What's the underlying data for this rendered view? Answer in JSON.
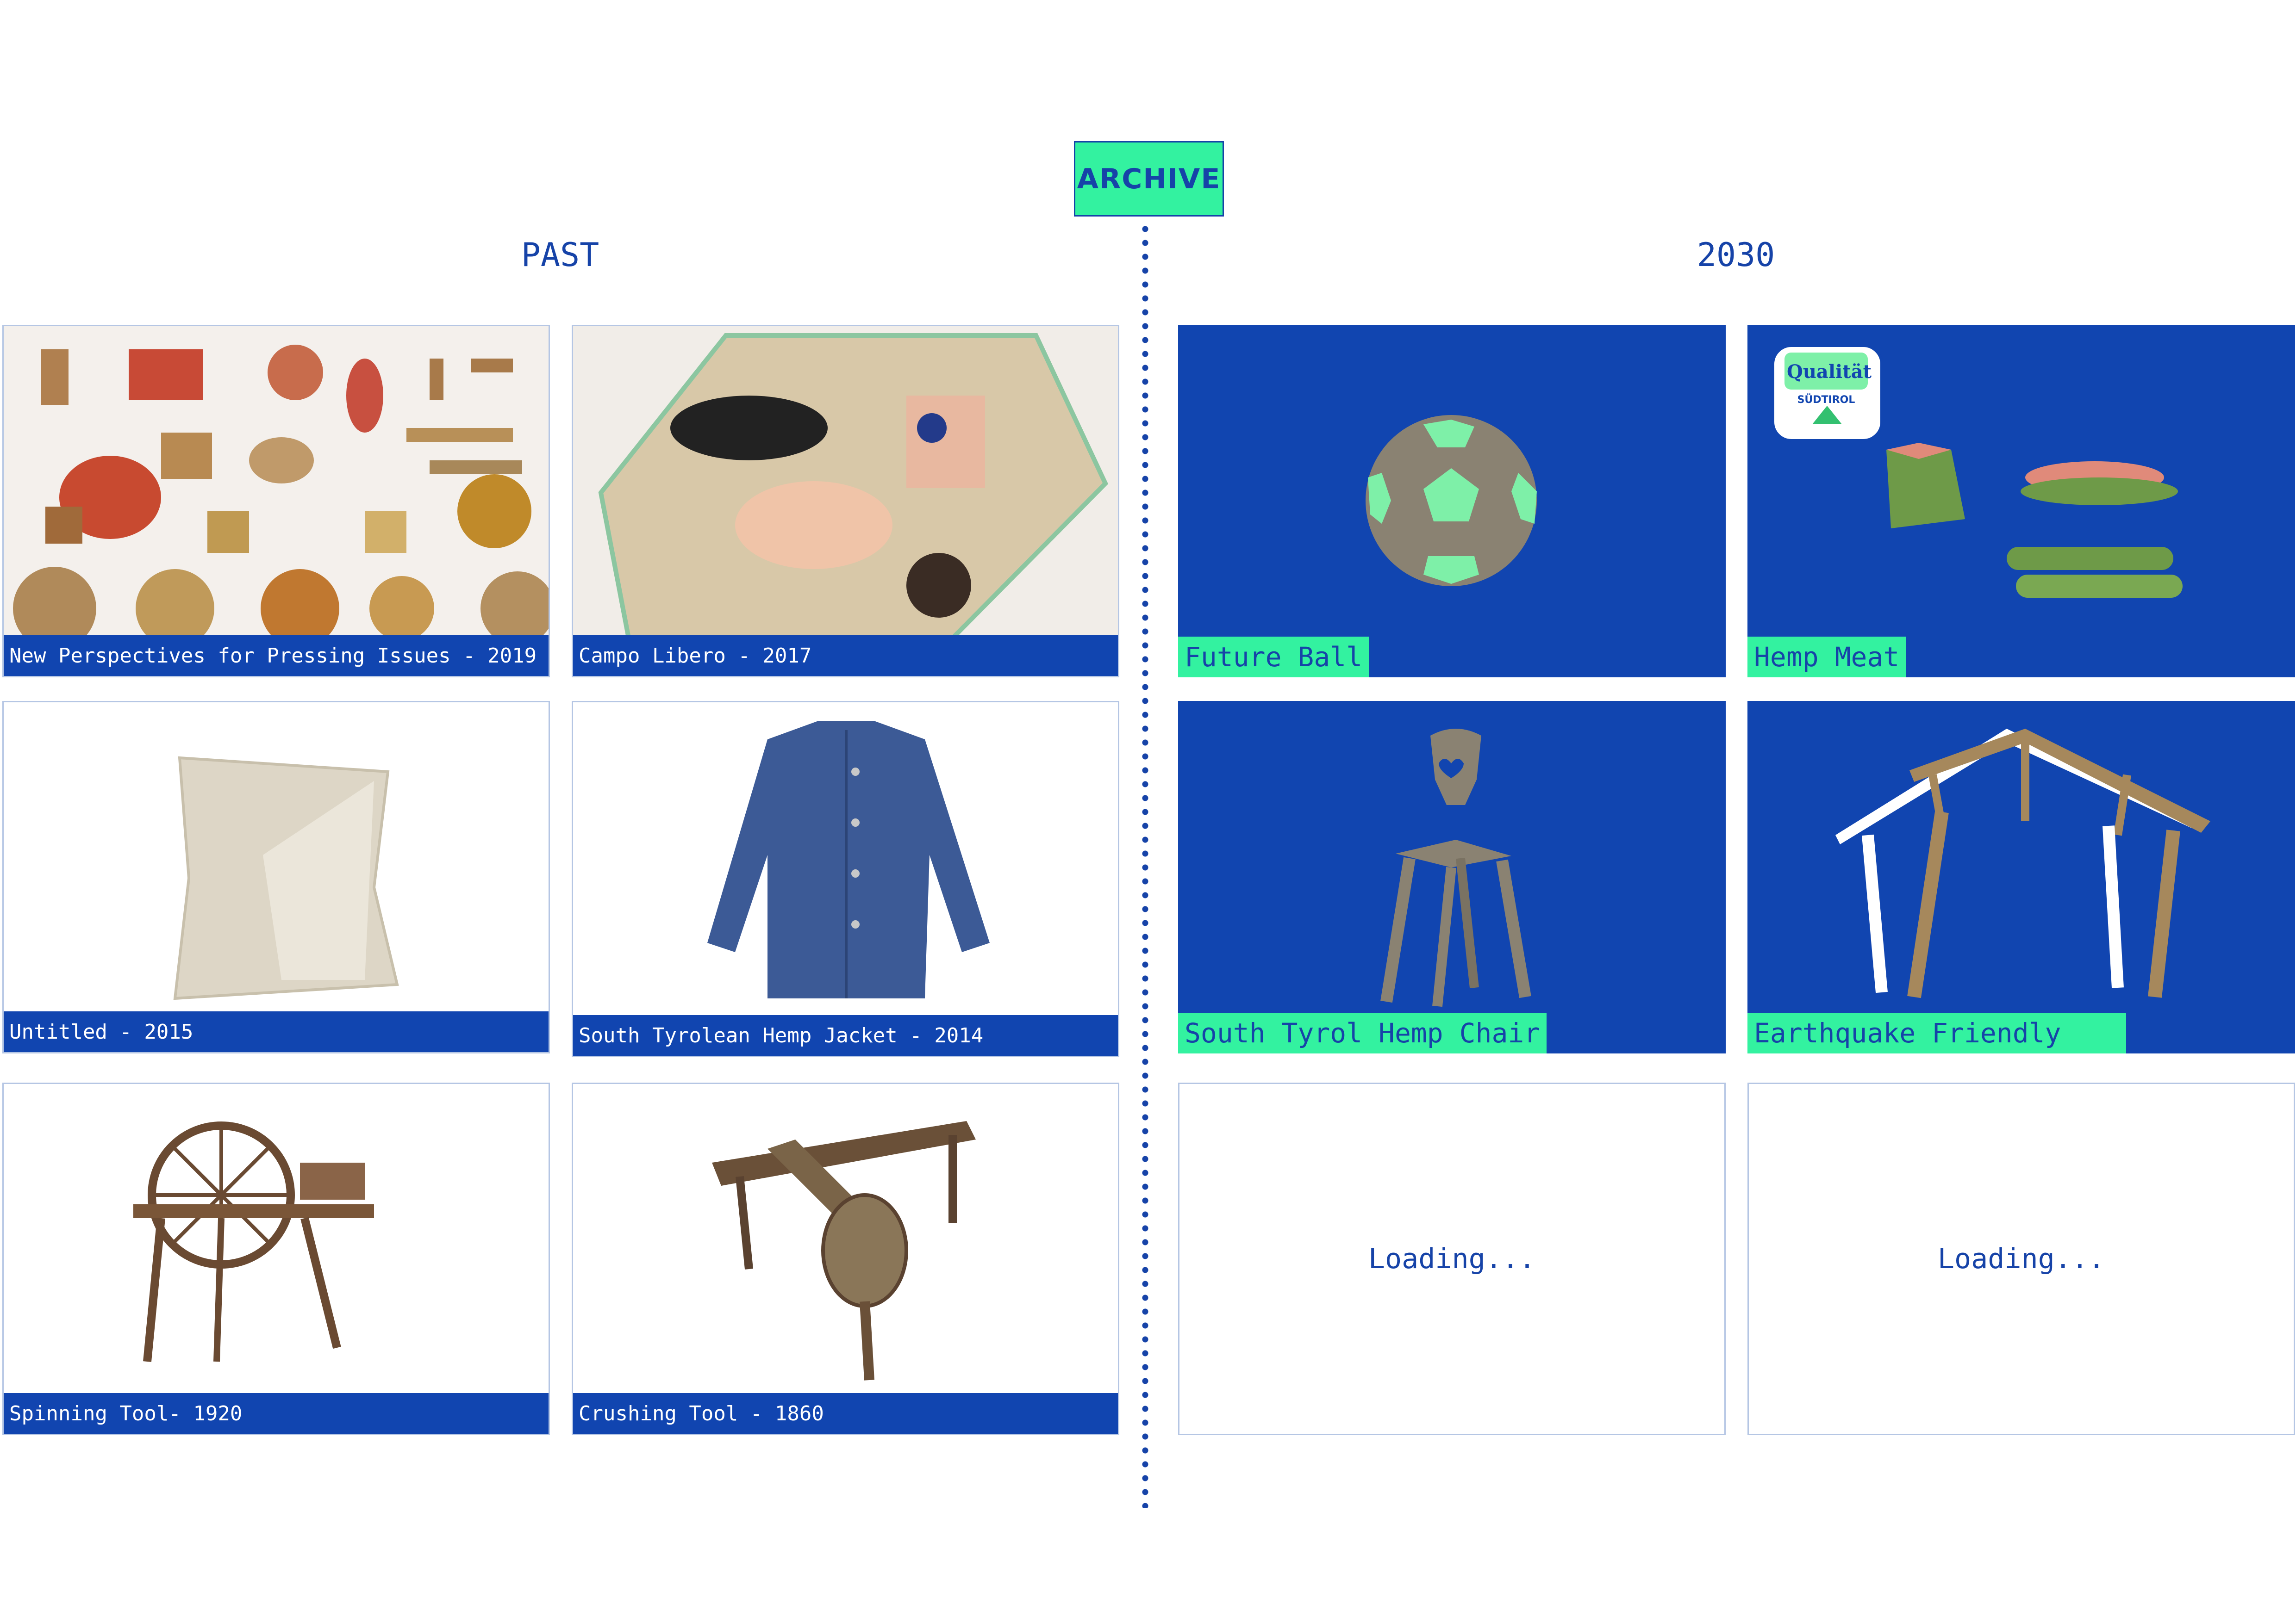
{
  "header": {
    "archive_label": "ARCHIVE"
  },
  "columns": {
    "past_title": "PAST",
    "future_title": "2030"
  },
  "past_cards": [
    {
      "caption": "New Perspectives for Pressing Issues - 2019",
      "image_icon": "hemp-objects-collection"
    },
    {
      "caption": "Campo Libero - 2017",
      "image_icon": "person-on-hemp-mat"
    },
    {
      "caption": "Untitled - 2015",
      "image_icon": "knitted-hemp-cloth"
    },
    {
      "caption": "South Tyrolean Hemp Jacket - 2014",
      "image_icon": "denim-hemp-jacket"
    },
    {
      "caption": "Spinning Tool- 1920",
      "image_icon": "spinning-wheel"
    },
    {
      "caption": "Crushing Tool - 1860",
      "image_icon": "hemp-crushing-tool"
    }
  ],
  "future_cards": [
    {
      "caption": "Future Ball",
      "image_icon": "hemp-football"
    },
    {
      "caption": "Hemp Meat",
      "image_icon": "hemp-meat-products",
      "badge_line1": "Qualität",
      "badge_line2": "SÜDTIROL"
    },
    {
      "caption": "South Tyrol Hemp Chair",
      "image_icon": "hemp-chair"
    },
    {
      "caption": "Earthquake Friendly",
      "image_icon": "hemp-roof-structure"
    }
  ],
  "loading_cards": [
    {
      "text": "Loading..."
    },
    {
      "text": "Loading..."
    }
  ],
  "colors": {
    "blue": "#1145b0",
    "green": "#33f2a0",
    "white": "#ffffff"
  }
}
